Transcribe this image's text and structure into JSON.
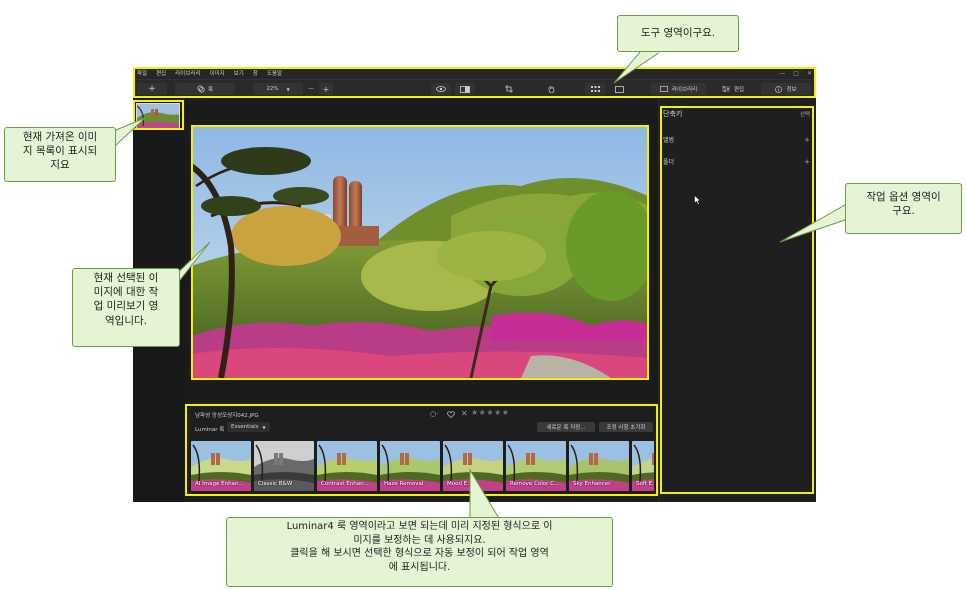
{
  "menubar": {
    "items": [
      "파일",
      "편집",
      "라이브러리",
      "이미지",
      "보기",
      "창",
      "도움말"
    ],
    "window_controls": [
      "—",
      "□",
      "✕"
    ]
  },
  "toolbar": {
    "add_label": "+",
    "looks_label": "룩",
    "zoom_value": "22%",
    "zoom_out": "—",
    "zoom_in": "+",
    "library_label": "라이브러리",
    "edit_label": "편집",
    "info_label": "정보"
  },
  "right_panel": {
    "shortcuts_label": "단축키",
    "select_label": "선택",
    "album_label": "앨범",
    "folder_label": "폴더",
    "add_icon": "+"
  },
  "looks_panel": {
    "filename": "남파성 앙성모성지042.JPG",
    "luminar_looks_label": "Luminar 룩",
    "category": "Essentials",
    "save_look_button": "새로운 룩 저장...",
    "reset_button": "조정 사항 초기화",
    "stars": "★★★★★",
    "looks": [
      {
        "name": "AI Image Enhan...",
        "tint": "#c8d98a",
        "mode": "color"
      },
      {
        "name": "Classic B&W",
        "tint": "#9a9a9a",
        "mode": "bw"
      },
      {
        "name": "Contrast Enhan...",
        "tint": "#b6cf6a",
        "mode": "color"
      },
      {
        "name": "Haze Removal",
        "tint": "#a9c86a",
        "mode": "color"
      },
      {
        "name": "Mood E...",
        "tint": "#c5d27f",
        "mode": "color"
      },
      {
        "name": "Remove Color C...",
        "tint": "#b2cc74",
        "mode": "color"
      },
      {
        "name": "Sky Enhancer",
        "tint": "#a7c46a",
        "mode": "color"
      },
      {
        "name": "Soft E...",
        "tint": "#c3d48a",
        "mode": "color"
      }
    ]
  },
  "callouts": {
    "tools": "도구 영역이구요.",
    "filmstrip": "현재 가져온 이미\n지 목록이 표시되\n지요",
    "preview": "현재 선택된 이\n미지에 대한 작\n업 미리보기 영\n역입니다.",
    "options": "작업 옵션 영역이\n구요.",
    "looks": "Luminar4 룩 영역이라고 보면 되는데 미리 지정된 형식으로 이\n미지를 보정하는 데 사용되지요.\n클릭을 해 보시면 선택한 형식으로 자동 보정이 되어 작업 영역\n에 표시됩니다."
  },
  "colors": {
    "highlight": "#f2f200",
    "callout_bg": "#e4f4d4",
    "callout_border": "#6f9a45",
    "app_bg": "#1b1b1c"
  }
}
